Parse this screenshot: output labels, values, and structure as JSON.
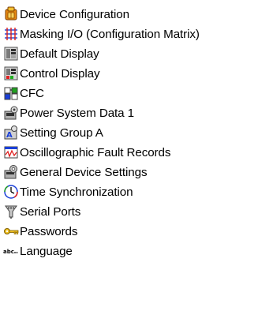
{
  "items": [
    {
      "label": "Device Configuration",
      "icon": "device-configuration-icon"
    },
    {
      "label": "Masking I/O (Configuration Matrix)",
      "icon": "masking-matrix-icon"
    },
    {
      "label": "Default Display",
      "icon": "default-display-icon"
    },
    {
      "label": "Control Display",
      "icon": "control-display-icon"
    },
    {
      "label": "CFC",
      "icon": "cfc-icon"
    },
    {
      "label": "Power System Data 1",
      "icon": "power-system-data-icon"
    },
    {
      "label": "Setting Group A",
      "icon": "setting-group-icon"
    },
    {
      "label": "Oscillographic Fault Records",
      "icon": "oscillographic-records-icon"
    },
    {
      "label": "General Device Settings",
      "icon": "general-settings-icon"
    },
    {
      "label": "Time Synchronization",
      "icon": "time-sync-icon"
    },
    {
      "label": "Serial Ports",
      "icon": "serial-ports-icon"
    },
    {
      "label": "Passwords",
      "icon": "key-icon"
    },
    {
      "label": "Language",
      "icon": "language-icon"
    }
  ],
  "colors": {
    "text": "#000000",
    "background": "#ffffff"
  }
}
